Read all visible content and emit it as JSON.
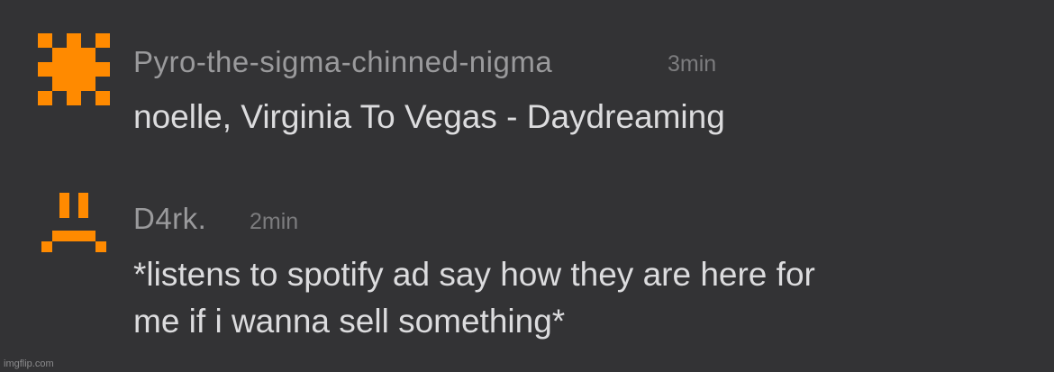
{
  "comments": [
    {
      "username": "Pyro-the-sigma-chinned-nigma",
      "time": "3min",
      "text": "noelle, Virginia To Vegas - Daydreaming",
      "avatar_icon": "orange-pixel-sun-avatar-icon"
    },
    {
      "username": "D4rk.",
      "time": "2min",
      "text_lines": [
        "*listens to spotify ad say how they are here for",
        "me if i wanna sell something*"
      ],
      "avatar_icon": "orange-pixel-sad-face-avatar-icon"
    }
  ],
  "watermark": "imgflip.com",
  "colors": {
    "background": "#333335",
    "avatar_orange": "#ff8a00",
    "username": "#9a9a9c",
    "time": "#7c7c7e",
    "text": "#dcdcde"
  }
}
